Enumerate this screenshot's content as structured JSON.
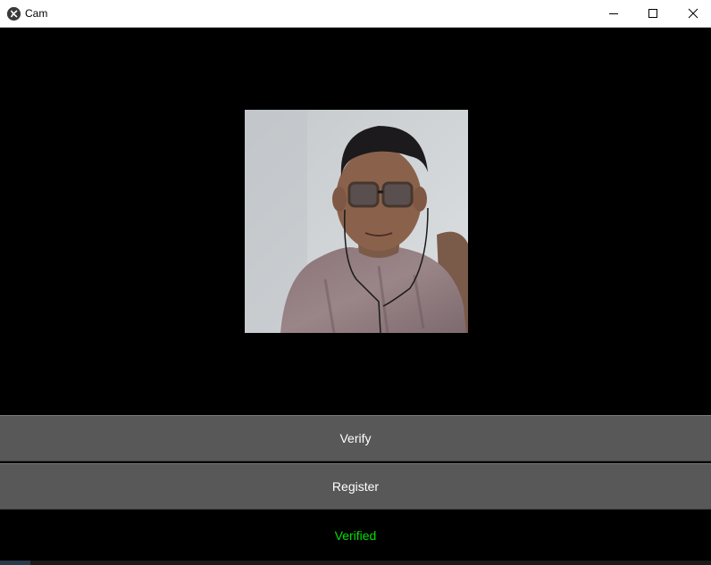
{
  "window": {
    "title": "Cam",
    "controls": {
      "minimize_icon": "minimize-icon",
      "maximize_icon": "maximize-icon",
      "close_icon": "close-icon"
    }
  },
  "camera": {
    "image_icon": "camera-feed"
  },
  "buttons": {
    "verify_label": "Verify",
    "register_label": "Register",
    "background_color": "#585858",
    "text_color": "#ffffff"
  },
  "status": {
    "text": "Verified",
    "color": "#00e000"
  }
}
